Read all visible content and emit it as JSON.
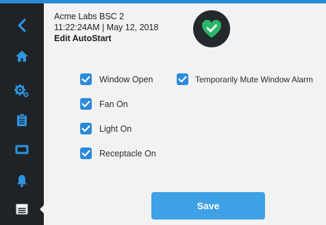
{
  "header": {
    "device_name": "Acme Labs BSC 2",
    "datetime": "11:22:24AM | May 12, 2018",
    "page_title": "Edit AutoStart"
  },
  "status": {
    "icon": "heart-check-icon",
    "color": "#2bb56a"
  },
  "sidebar": {
    "items": [
      {
        "icon": "back-chevron-icon"
      },
      {
        "icon": "home-icon"
      },
      {
        "icon": "settings-gears-icon"
      },
      {
        "icon": "clipboard-icon"
      },
      {
        "icon": "display-icon"
      },
      {
        "icon": "bell-icon"
      },
      {
        "icon": "list-icon",
        "active": true
      }
    ]
  },
  "options": [
    {
      "label": "Window Open",
      "checked": true
    },
    {
      "label": "Fan On",
      "checked": true
    },
    {
      "label": "Light On",
      "checked": true
    },
    {
      "label": "Receptacle On",
      "checked": true
    },
    {
      "label": "Temporarily Mute Window Alarm",
      "checked": true
    }
  ],
  "actions": {
    "save_label": "Save"
  },
  "colors": {
    "accent": "#2c8ad9",
    "save_button": "#3ea1e6",
    "sidebar": "#1f2326",
    "sidebar_icon": "#2e95e0"
  }
}
